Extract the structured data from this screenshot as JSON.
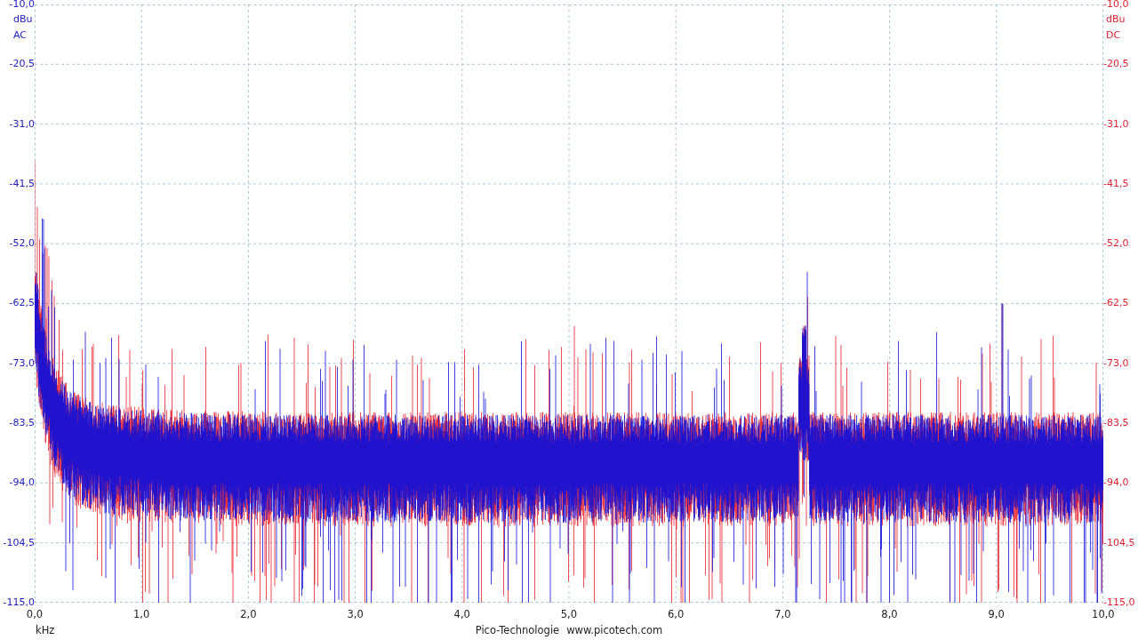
{
  "left_axis": {
    "unit": "dBu",
    "coupling": "AC",
    "ticks": [
      "-10,0",
      "-20,5",
      "-31,0",
      "-41,5",
      "-52,0",
      "-62,5",
      "-73,0",
      "-83,5",
      "-94,0",
      "-104,5",
      "-115,0"
    ]
  },
  "right_axis": {
    "unit": "dBu",
    "coupling": "DC",
    "ticks": [
      "-10,0",
      "-20,5",
      "-31,0",
      "-41,5",
      "-52,0",
      "-62,5",
      "-73,0",
      "-83,5",
      "-94,0",
      "-104,5",
      "-115,0"
    ]
  },
  "x_axis": {
    "unit": "kHz",
    "ticks": [
      "0,0",
      "1,0",
      "2,0",
      "3,0",
      "4,0",
      "5,0",
      "6,0",
      "7,0",
      "8,0",
      "9,0",
      "10,0"
    ]
  },
  "footer": {
    "brand": "Pico-Technologie",
    "url": "www.picotech.com"
  }
}
